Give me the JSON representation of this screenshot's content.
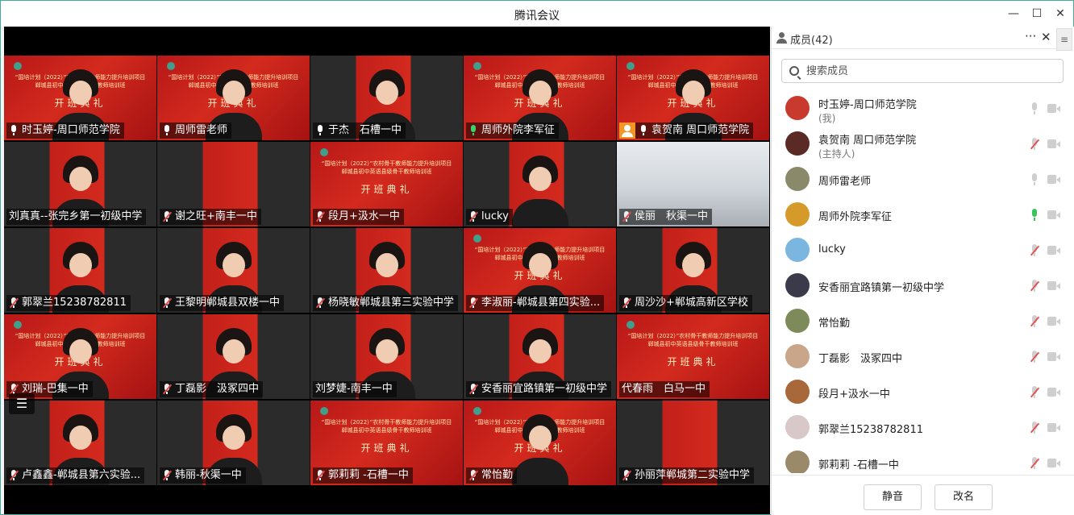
{
  "window": {
    "title": "腾讯会议",
    "minimize": "—",
    "maximize": "☐",
    "close": "✕"
  },
  "tiles": [
    {
      "name": "时玉婷-周口师范学院",
      "mic": "on"
    },
    {
      "name": "周师雷老师",
      "mic": "on"
    },
    {
      "name": "于杰　石槽一中",
      "mic": "on"
    },
    {
      "name": "周师外院李军征",
      "mic": "speaking"
    },
    {
      "name": "袁贺南 周口师范学院",
      "mic": "on",
      "host": true
    },
    {
      "name": "刘真真--张完乡第一初级中学",
      "mic": "none"
    },
    {
      "name": "谢之旺+南丰一中",
      "mic": "muted"
    },
    {
      "name": "段月+汲水一中",
      "mic": "muted"
    },
    {
      "name": "lucky",
      "mic": "muted"
    },
    {
      "name": "侯丽　秋渠一中",
      "mic": "muted"
    },
    {
      "name": "郭翠兰15238782811",
      "mic": "muted"
    },
    {
      "name": "王黎明郸城县双楼一中",
      "mic": "muted"
    },
    {
      "name": "杨晓敏郸城县第三实验中学",
      "mic": "muted"
    },
    {
      "name": "李淑丽-郸城县第四实验...",
      "mic": "muted"
    },
    {
      "name": "周沙沙+郸城高新区学校",
      "mic": "muted"
    },
    {
      "name": "刘瑞-巴集一中",
      "mic": "muted"
    },
    {
      "name": "丁磊影　汲冢四中",
      "mic": "muted"
    },
    {
      "name": "刘梦婕-南丰一中",
      "mic": "none"
    },
    {
      "name": "安香丽宜路镇第一初级中学",
      "mic": "muted"
    },
    {
      "name": "代春雨　白马一中",
      "mic": "none"
    },
    {
      "name": "卢鑫鑫-郸城县第六实验...",
      "mic": "muted"
    },
    {
      "name": "韩丽-秋渠一中",
      "mic": "muted"
    },
    {
      "name": "郭莉莉 -石槽一中",
      "mic": "muted"
    },
    {
      "name": "常怡勤",
      "mic": "muted"
    },
    {
      "name": "孙丽萍郸城第二实验中学",
      "mic": "muted"
    }
  ],
  "slide": {
    "line1": "“国培计划（2022）”农村骨干教师能力提升培训项目",
    "line2": "郸城县初中英语县级骨干教师培训班",
    "ceremony": "开班典礼"
  },
  "panel": {
    "title": "成员(42)",
    "more": "···",
    "close": "✕",
    "side_tab": "≡",
    "search_placeholder": "搜索成员",
    "members": [
      {
        "name": "时玉婷-周口师范学院",
        "role": "(我)",
        "mic": "idle",
        "avatar_color": "#c93a2e"
      },
      {
        "name": "袁贺南 周口师范学院",
        "role": "(主持人)",
        "mic": "muted",
        "avatar_color": "#5a2a24"
      },
      {
        "name": "周师雷老师",
        "role": "",
        "mic": "idle",
        "avatar_color": "#8a8a6a"
      },
      {
        "name": "周师外院李军征",
        "role": "",
        "mic": "speaking",
        "avatar_color": "#d59a2a"
      },
      {
        "name": "lucky",
        "role": "",
        "mic": "muted",
        "avatar_color": "#7ab6e0"
      },
      {
        "name": "安香丽宜路镇第一初级中学",
        "role": "",
        "mic": "muted",
        "avatar_color": "#3a3a4a"
      },
      {
        "name": "常怡勤",
        "role": "",
        "mic": "muted",
        "avatar_color": "#7d8a5a"
      },
      {
        "name": "丁磊影　汲冢四中",
        "role": "",
        "mic": "muted",
        "avatar_color": "#c9a58a"
      },
      {
        "name": "段月+汲水一中",
        "role": "",
        "mic": "muted",
        "avatar_color": "#a8683a"
      },
      {
        "name": "郭翠兰15238782811",
        "role": "",
        "mic": "muted",
        "avatar_color": "#d8c8c8"
      },
      {
        "name": "郭莉莉 -石槽一中",
        "role": "",
        "mic": "muted",
        "avatar_color": "#9a8a6a"
      }
    ],
    "mute_all": "静音",
    "rename": "改名"
  }
}
